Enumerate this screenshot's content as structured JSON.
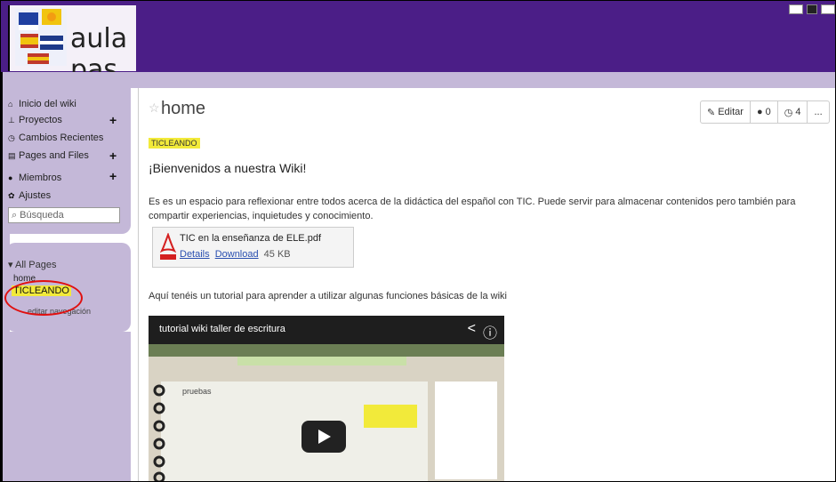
{
  "header": {
    "site_name": "aula pas"
  },
  "sidebar": {
    "nav": [
      {
        "label": "Inicio del wiki",
        "icon": "home-icon"
      },
      {
        "label": "Proyectos",
        "icon": "sitemap-icon"
      },
      {
        "label": "Cambios Recientes",
        "icon": "clock-icon"
      },
      {
        "label": "Pages and Files",
        "icon": "file-icon"
      },
      {
        "label": "Miembros",
        "icon": "user-icon"
      },
      {
        "label": "Ajustes",
        "icon": "gear-icon"
      }
    ],
    "plus": "+",
    "search_placeholder": "Búsqueda",
    "all_pages": "All Pages",
    "pages": [
      "home",
      "TICLEANDO"
    ],
    "edit_nav": "editar navegación"
  },
  "page": {
    "title": "home",
    "toolbar": {
      "edit": "Editar",
      "comments": "0",
      "history": "4",
      "more": "..."
    },
    "tag": "TICLEANDO",
    "welcome": "¡Bienvenidos a nuestra Wiki!",
    "paragraph": "Es es un espacio para reflexionar entre todos acerca de la didáctica del español con TIC. Puede servir para almacenar contenidos pero también para compartir experiencias, inquietudes y conocimiento.",
    "attachment": {
      "name": "TIC en la enseñanza de ELE.pdf",
      "details": "Details",
      "download": "Download",
      "size": "45 KB"
    },
    "tutorial_text": "Aquí tenéis un tutorial para aprender a utilizar algunas funciones básicas de la wiki",
    "video": {
      "title": "tutorial wiki taller de escritura",
      "inner_page_title": "pruebas"
    }
  },
  "colors": {
    "header": "#4b1e87",
    "sidebar": "#c4b8d8",
    "highlight": "#f2ea3a",
    "annotation": "#e01010"
  }
}
